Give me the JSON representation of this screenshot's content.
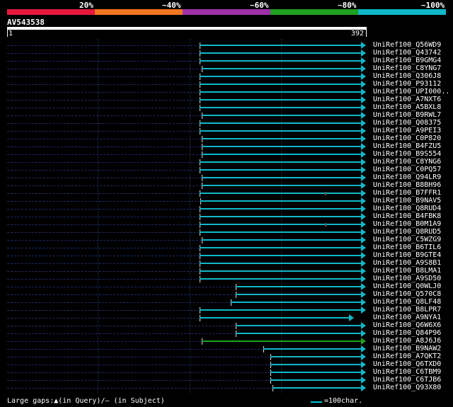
{
  "legend": {
    "labels": [
      "20%",
      "~40%",
      "~60%",
      "~80%",
      "~100%"
    ],
    "colors": [
      "#e8183c",
      "#f07820",
      "#a030a8",
      "#20a020",
      "#10b8c8"
    ]
  },
  "query": {
    "id": "AV543538",
    "start": "1",
    "end": "392",
    "length": 392
  },
  "hits": [
    {
      "name": "UniRef100_Q56WD9",
      "start": 210,
      "end": 392,
      "color": "#10b8c8"
    },
    {
      "name": "UniRef100_Q43742",
      "start": 210,
      "end": 392,
      "color": "#10b8c8"
    },
    {
      "name": "UniRef100_B9GMG4",
      "start": 210,
      "end": 392,
      "color": "#10b8c8"
    },
    {
      "name": "UniRef100_C8YNG7",
      "start": 213,
      "end": 392,
      "color": "#10b8c8"
    },
    {
      "name": "UniRef100_Q306J8",
      "start": 210,
      "end": 392,
      "color": "#10b8c8"
    },
    {
      "name": "UniRef100_P93112",
      "start": 210,
      "end": 392,
      "color": "#10b8c8"
    },
    {
      "name": "UniRef100_UPI000..",
      "start": 210,
      "end": 392,
      "color": "#10b8c8"
    },
    {
      "name": "UniRef100_A7NXT6",
      "start": 210,
      "end": 392,
      "color": "#10b8c8"
    },
    {
      "name": "UniRef100_A5BXL8",
      "start": 210,
      "end": 392,
      "color": "#10b8c8"
    },
    {
      "name": "UniRef100_B9RWL7",
      "start": 213,
      "end": 392,
      "color": "#10b8c8"
    },
    {
      "name": "UniRef100_Q08375",
      "start": 210,
      "end": 392,
      "color": "#10b8c8"
    },
    {
      "name": "UniRef100_A9PEI3",
      "start": 210,
      "end": 392,
      "color": "#10b8c8"
    },
    {
      "name": "UniRef100_C0P820",
      "start": 213,
      "end": 392,
      "color": "#10b8c8"
    },
    {
      "name": "UniRef100_B4FZU5",
      "start": 213,
      "end": 392,
      "color": "#10b8c8"
    },
    {
      "name": "UniRef100_B9S554",
      "start": 213,
      "end": 392,
      "color": "#10b8c8"
    },
    {
      "name": "UniRef100_C8YNG6",
      "start": 210,
      "end": 392,
      "color": "#10b8c8"
    },
    {
      "name": "UniRef100_C0PQ57",
      "start": 210,
      "end": 392,
      "color": "#10b8c8"
    },
    {
      "name": "UniRef100_Q94LR9",
      "start": 213,
      "end": 392,
      "color": "#10b8c8"
    },
    {
      "name": "UniRef100_B8BH96",
      "start": 213,
      "end": 392,
      "color": "#10b8c8"
    },
    {
      "name": "UniRef100_B7FFR1",
      "start": 210,
      "end": 392,
      "color": "#10b8c8",
      "gap": 347
    },
    {
      "name": "UniRef100_B9NAV5",
      "start": 211,
      "end": 392,
      "color": "#10b8c8"
    },
    {
      "name": "UniRef100_Q8RUD4",
      "start": 210,
      "end": 392,
      "color": "#10b8c8"
    },
    {
      "name": "UniRef100_B4FBK8",
      "start": 210,
      "end": 392,
      "color": "#10b8c8"
    },
    {
      "name": "UniRef100_B0M1A9",
      "start": 210,
      "end": 392,
      "color": "#10b8c8",
      "gap": 347
    },
    {
      "name": "UniRef100_Q8RUD5",
      "start": 210,
      "end": 392,
      "color": "#10b8c8"
    },
    {
      "name": "UniRef100_C5WZG9",
      "start": 213,
      "end": 392,
      "color": "#10b8c8"
    },
    {
      "name": "UniRef100_B6TIL6",
      "start": 210,
      "end": 392,
      "color": "#10b8c8"
    },
    {
      "name": "UniRef100_B9GTE4",
      "start": 210,
      "end": 392,
      "color": "#10b8c8"
    },
    {
      "name": "UniRef100_A9S8B1",
      "start": 210,
      "end": 392,
      "color": "#10b8c8"
    },
    {
      "name": "UniRef100_B8LMA1",
      "start": 210,
      "end": 392,
      "color": "#10b8c8"
    },
    {
      "name": "UniRef100_A9SD50",
      "start": 210,
      "end": 392,
      "color": "#10b8c8"
    },
    {
      "name": "UniRef100_Q0WLJ0",
      "start": 250,
      "end": 392,
      "color": "#10b8c8"
    },
    {
      "name": "UniRef100_Q570C8",
      "start": 250,
      "end": 392,
      "color": "#10b8c8"
    },
    {
      "name": "UniRef100_Q8LF48",
      "start": 244,
      "end": 392,
      "color": "#10b8c8"
    },
    {
      "name": "UniRef100_B8LPR7",
      "start": 210,
      "end": 392,
      "color": "#10b8c8"
    },
    {
      "name": "UniRef100_A9NYA1",
      "start": 210,
      "end": 379,
      "color": "#10b8c8"
    },
    {
      "name": "UniRef100_Q6W6X6",
      "start": 250,
      "end": 392,
      "color": "#10b8c8"
    },
    {
      "name": "UniRef100_Q84P96",
      "start": 250,
      "end": 392,
      "color": "#10b8c8"
    },
    {
      "name": "UniRef100_A8J6J6",
      "start": 213,
      "end": 392,
      "color": "#20a020"
    },
    {
      "name": "UniRef100_B9NAW2",
      "start": 280,
      "end": 392,
      "color": "#10b8c8"
    },
    {
      "name": "UniRef100_A7QKT2",
      "start": 288,
      "end": 392,
      "color": "#10b8c8"
    },
    {
      "name": "UniRef100_Q6TXD0",
      "start": 288,
      "end": 392,
      "color": "#10b8c8"
    },
    {
      "name": "UniRef100_C6TBM9",
      "start": 288,
      "end": 392,
      "color": "#10b8c8"
    },
    {
      "name": "UniRef100_C6TJB6",
      "start": 288,
      "end": 392,
      "color": "#10b8c8"
    },
    {
      "name": "UniRef100_Q93X80",
      "start": 290,
      "end": 392,
      "color": "#10b8c8"
    }
  ],
  "footer": {
    "gaps_text": "Large gaps:▲(in Query)/– (in Subject)",
    "scale_text": "=100char."
  }
}
